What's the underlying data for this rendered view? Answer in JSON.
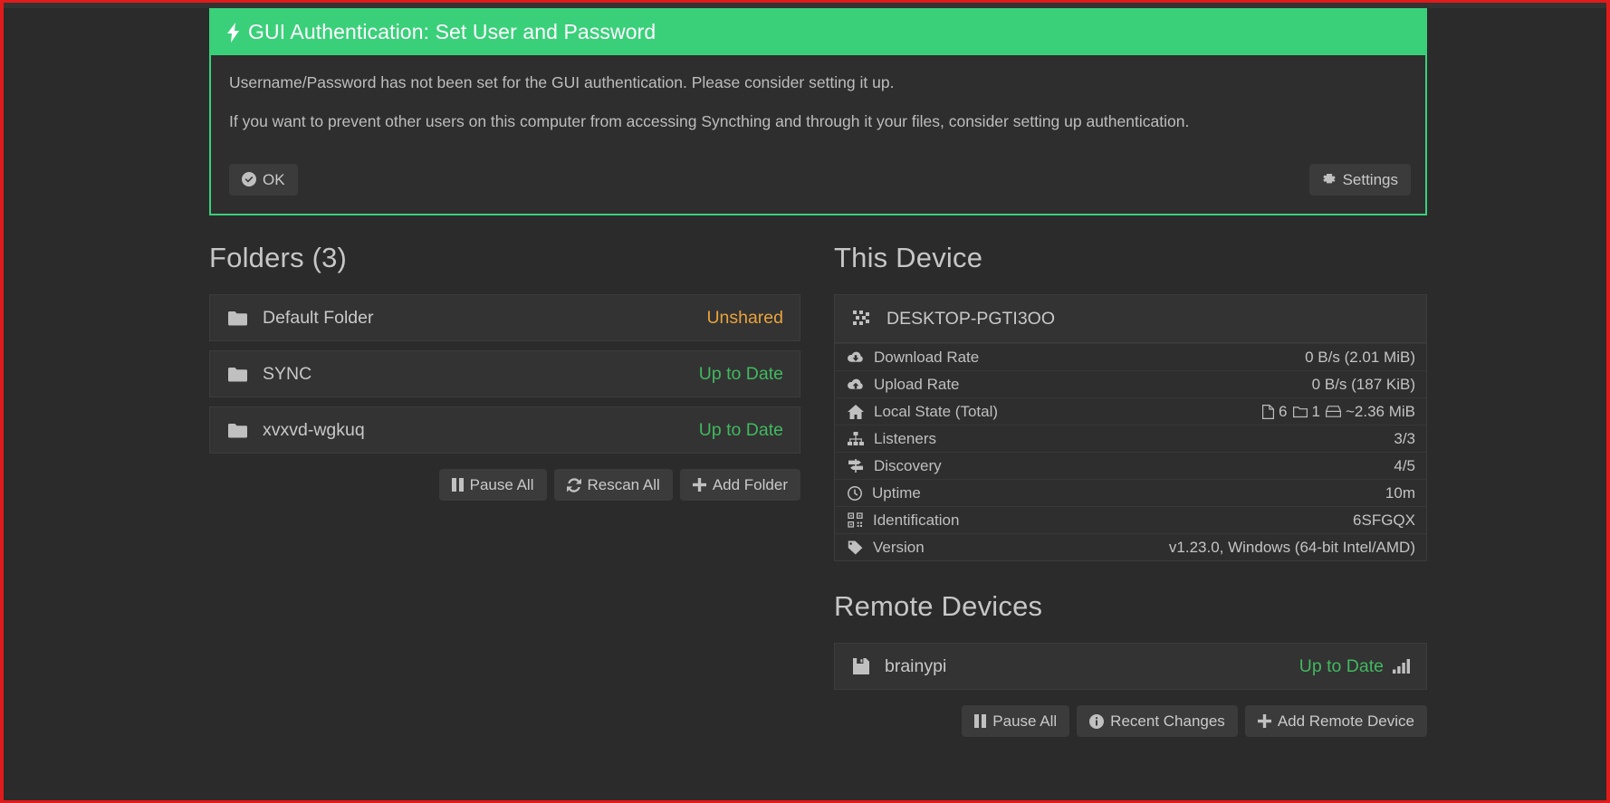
{
  "alert": {
    "title": "GUI Authentication: Set User and Password",
    "icon": "bolt-icon",
    "body_line1": "Username/Password has not been set for the GUI authentication. Please consider setting it up.",
    "body_line2": "If you want to prevent other users on this computer from accessing Syncthing and through it your files, consider setting up authentication.",
    "ok_label": "OK",
    "ok_icon": "check-circle-icon",
    "settings_label": "Settings",
    "settings_icon": "gear-icon",
    "accent_color": "#3ad07a"
  },
  "folders": {
    "heading": "Folders (3)",
    "items": [
      {
        "name": "Default Folder",
        "status": "Unshared",
        "status_color": "#e8a33d",
        "icon": "folder-icon"
      },
      {
        "name": "SYNC",
        "status": "Up to Date",
        "status_color": "#41b860",
        "icon": "folder-icon"
      },
      {
        "name": "xvxvd-wgkuq",
        "status": "Up to Date",
        "status_color": "#41b860",
        "icon": "folder-icon"
      }
    ],
    "buttons": [
      {
        "label": "Pause All",
        "icon": "pause-icon"
      },
      {
        "label": "Rescan All",
        "icon": "refresh-icon"
      },
      {
        "label": "Add Folder",
        "icon": "plus-icon"
      }
    ]
  },
  "this_device": {
    "heading": "This Device",
    "name": "DESKTOP-PGTI3OO",
    "icon": "device-grid-icon",
    "stats": [
      {
        "label": "Download Rate",
        "icon": "cloud-download-icon",
        "value": "0 B/s (2.01 MiB)"
      },
      {
        "label": "Upload Rate",
        "icon": "cloud-upload-icon",
        "value": "0 B/s (187 KiB)"
      },
      {
        "label": "Local State (Total)",
        "icon": "home-icon",
        "files": "6",
        "folders": "1",
        "size": "~2.36 MiB"
      },
      {
        "label": "Listeners",
        "icon": "sitemap-icon",
        "value": "3/3",
        "value_color": "#41b860"
      },
      {
        "label": "Discovery",
        "icon": "signpost-icon",
        "value": "4/5",
        "value_color": "#4aa3df"
      },
      {
        "label": "Uptime",
        "icon": "clock-icon",
        "value": "10m"
      },
      {
        "label": "Identification",
        "icon": "qrcode-icon",
        "value": "6SFGQX",
        "value_color": "#4aa3df"
      },
      {
        "label": "Version",
        "icon": "tag-icon",
        "value": "v1.23.0, Windows (64-bit Intel/AMD)"
      }
    ]
  },
  "remote_devices": {
    "heading": "Remote Devices",
    "items": [
      {
        "name": "brainypi",
        "status": "Up to Date",
        "status_color": "#41b860",
        "icon": "save-device-icon",
        "signal_icon": "signal-bars-icon"
      }
    ],
    "buttons": [
      {
        "label": "Pause All",
        "icon": "pause-icon"
      },
      {
        "label": "Recent Changes",
        "icon": "info-circle-icon"
      },
      {
        "label": "Add Remote Device",
        "icon": "plus-icon"
      }
    ]
  }
}
